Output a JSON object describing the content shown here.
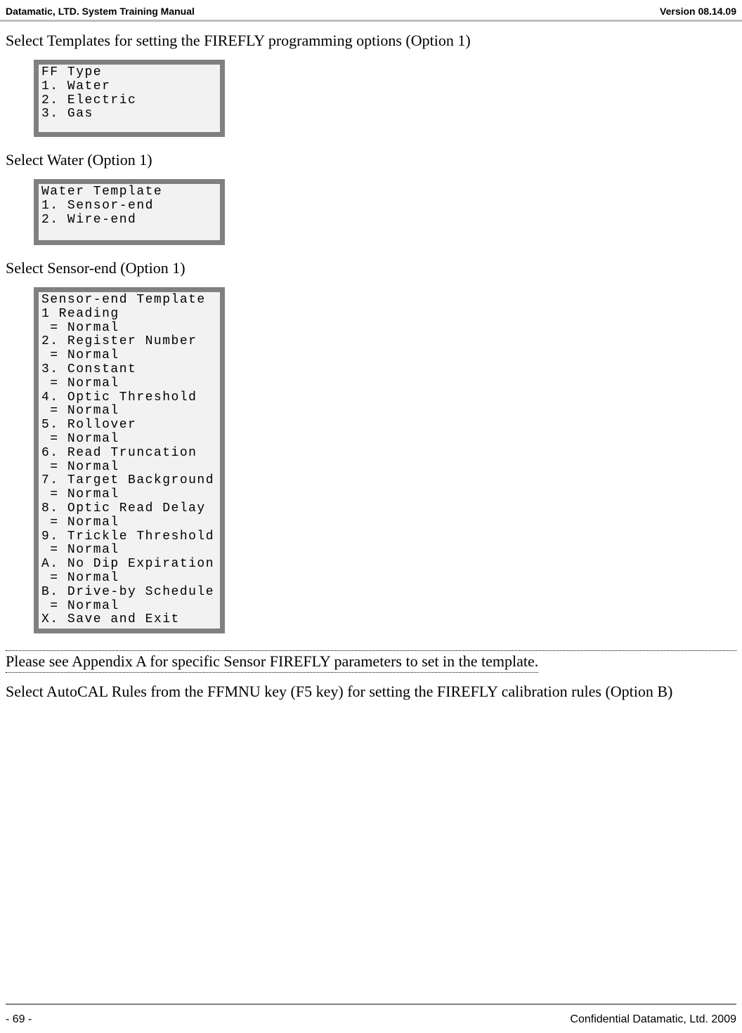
{
  "header": {
    "left": "Datamatic, LTD. System Training  Manual",
    "right": "Version 08.14.09"
  },
  "para1": "Select Templates for setting the FIREFLY programming options (Option 1)",
  "lcd1": "FF Type\n1. Water\n2. Electric\n3. Gas",
  "para2": "Select Water (Option 1)",
  "lcd2": "Water Template\n1. Sensor-end\n2. Wire-end",
  "para3": "Select Sensor-end (Option 1)",
  "lcd3": "Sensor-end Template\n1 Reading\n = Normal\n2. Register Number\n = Normal\n3. Constant\n = Normal\n4. Optic Threshold\n = Normal\n5. Rollover\n = Normal\n6. Read Truncation\n = Normal\n7. Target Background\n = Normal\n8. Optic Read Delay\n = Normal\n9. Trickle Threshold\n = Normal\nA. No Dip Expiration\n = Normal\nB. Drive-by Schedule\n = Normal\nX. Save and Exit",
  "appendix_note": "Please see Appendix A for specific Sensor FIREFLY parameters to set in the template.",
  "para4": "Select AutoCAL Rules from the FFMNU key (F5 key) for setting the FIREFLY calibration rules (Option B)",
  "footer": {
    "page": "- 69 -",
    "confidential": "Confidential Datamatic, Ltd. 2009"
  }
}
